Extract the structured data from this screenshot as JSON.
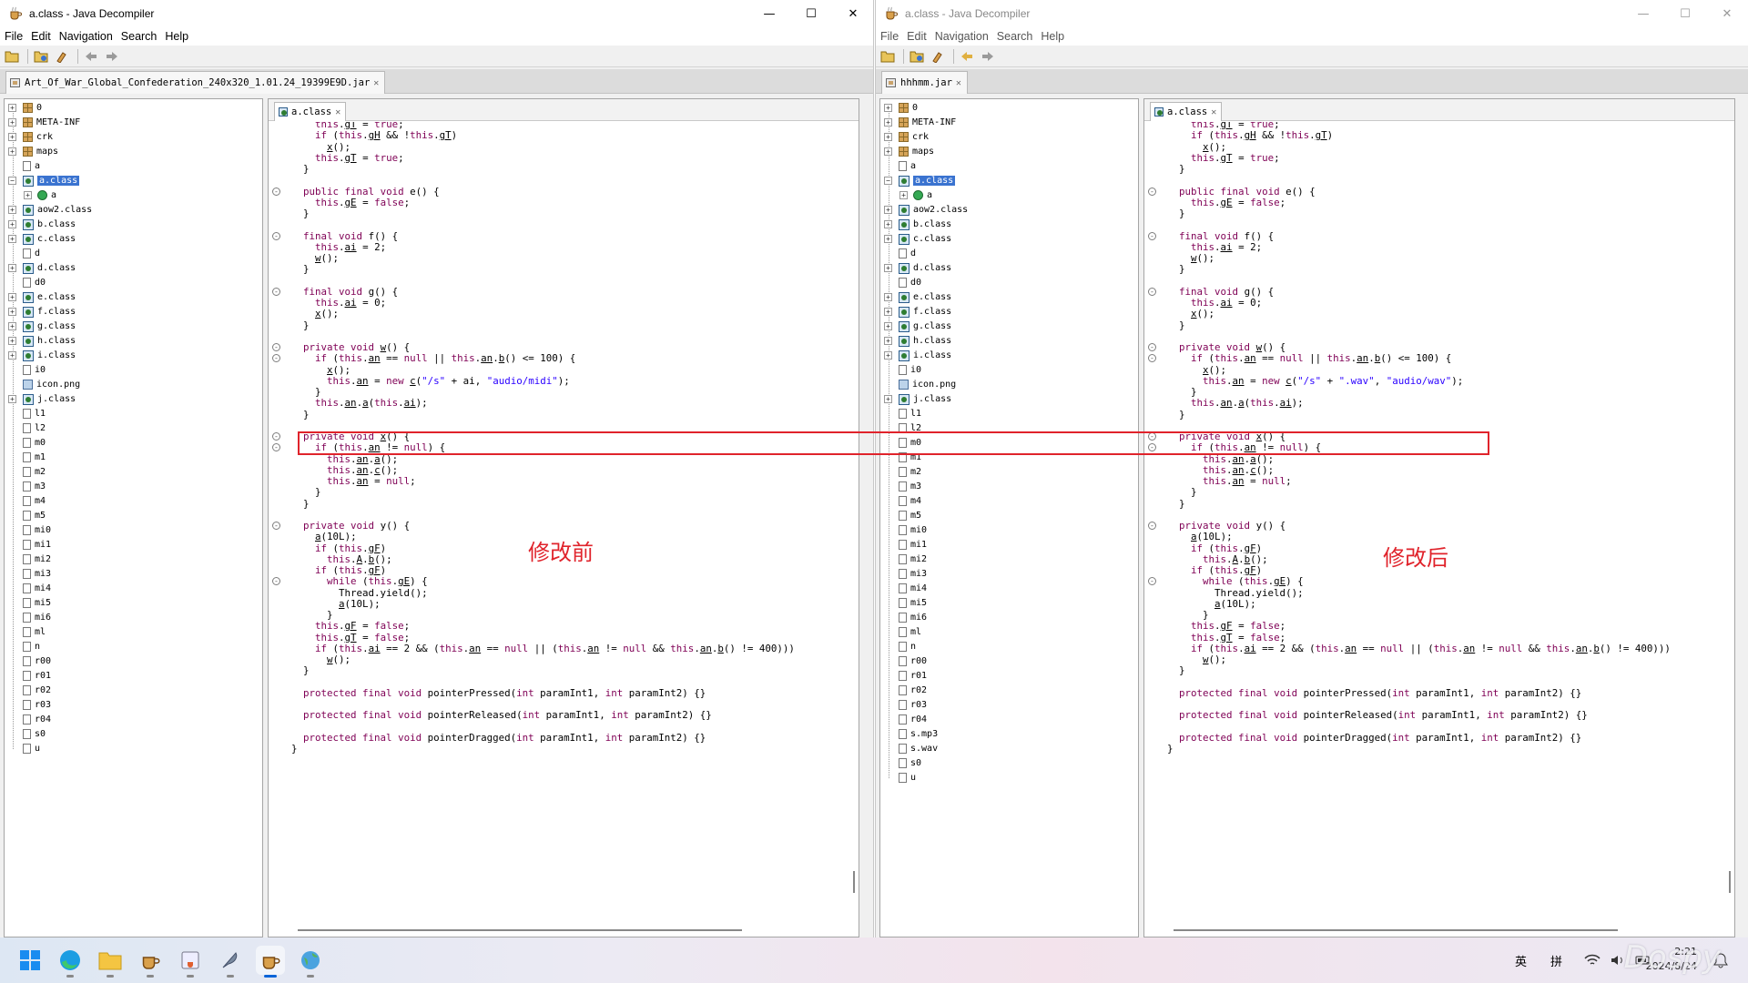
{
  "windows": [
    {
      "title": "a.class - Java Decompiler",
      "menu": [
        "File",
        "Edit",
        "Navigation",
        "Search",
        "Help"
      ],
      "file_tab": "Art_Of_War_Global_Confederation_240x320_1.01.24_19399E9D.jar",
      "editor_tab": "a.class",
      "tree": [
        "0",
        "META-INF",
        "crk",
        "maps",
        "a",
        "a.class",
        "a",
        "aow2.class",
        "b.class",
        "c.class",
        "d",
        "d.class",
        "d0",
        "e.class",
        "f.class",
        "g.class",
        "h.class",
        "i.class",
        "i0",
        "icon.png",
        "j.class",
        "l1",
        "l2",
        "m0",
        "m1",
        "m2",
        "m3",
        "m4",
        "m5",
        "mi0",
        "mi1",
        "mi2",
        "mi3",
        "mi4",
        "mi5",
        "mi6",
        "ml",
        "n",
        "r00",
        "r01",
        "r02",
        "r03",
        "r04",
        "s0",
        "u"
      ],
      "annotation": "修改前",
      "highlight_line": "this.an = new c(\"/s\" + ai, \"audio/midi\");"
    },
    {
      "title": "a.class - Java Decompiler",
      "menu": [
        "File",
        "Edit",
        "Navigation",
        "Search",
        "Help"
      ],
      "file_tab": "hhhmm.jar",
      "editor_tab": "a.class",
      "tree": [
        "0",
        "META-INF",
        "crk",
        "maps",
        "a",
        "a.class",
        "a",
        "aow2.class",
        "b.class",
        "c.class",
        "d",
        "d.class",
        "d0",
        "e.class",
        "f.class",
        "g.class",
        "h.class",
        "i.class",
        "i0",
        "icon.png",
        "j.class",
        "l1",
        "l2",
        "m0",
        "m1",
        "m2",
        "m3",
        "m4",
        "m5",
        "mi0",
        "mi1",
        "mi2",
        "mi3",
        "mi4",
        "mi5",
        "mi6",
        "ml",
        "n",
        "r00",
        "r01",
        "r02",
        "r03",
        "r04",
        "s.mp3",
        "s.wav",
        "s0",
        "u"
      ],
      "annotation": "修改后",
      "highlight_line": "this.an = new c(\"/s\" + \".wav\", \"audio/wav\");"
    }
  ],
  "code_lines": [
    "    this.gT = true;",
    "    if (this.gH && !this.gT)",
    "      x();",
    "    this.gT = true;",
    "  }",
    "",
    "  public final void e() {",
    "    this.gE = false;",
    "  }",
    "",
    "  final void f() {",
    "    this.ai = 2;",
    "    w();",
    "  }",
    "",
    "  final void g() {",
    "    this.ai = 0;",
    "    x();",
    "  }",
    "",
    "  private void w() {",
    "    if (this.an == null || this.an.b() <= 100) {",
    "      x();",
    "      __HL__",
    "    }",
    "    this.an.a(this.ai);",
    "  }",
    "",
    "  private void x() {",
    "    if (this.an != null) {",
    "      this.an.a();",
    "      this.an.c();",
    "      this.an = null;",
    "    }",
    "  }",
    "",
    "  private void y() {",
    "    a(10L);",
    "    if (this.gF)",
    "      this.A.b();",
    "    if (this.gF)",
    "      while (this.gE) {",
    "        Thread.yield();",
    "        a(10L);",
    "      }",
    "    this.gF = false;",
    "    this.gT = false;",
    "    if (this.ai == 2 && (this.an == null || (this.an != null && this.an.b() != 400)))",
    "      w();",
    "  }",
    "",
    "  protected final void pointerPressed(int paramInt1, int paramInt2) {}",
    "",
    "  protected final void pointerReleased(int paramInt1, int paramInt2) {}",
    "",
    "  protected final void pointerDragged(int paramInt1, int paramInt2) {}",
    "}"
  ],
  "fold_markers": [
    "-",
    "-",
    "-",
    "-",
    "-",
    "-",
    "-",
    "-",
    "-",
    "-"
  ],
  "taskbar": {
    "apps": [
      "windows-start",
      "edge-browser",
      "file-explorer",
      "java-decompiler",
      "java-app",
      "feather-app",
      "java-decompiler-active",
      "globe-app"
    ],
    "ime1": "英",
    "ime2": "拼",
    "time": "2:21",
    "date": "2024/8/24",
    "watermark": "Dospy"
  },
  "colors": {
    "highlight": "#e0232b",
    "selection": "#3a73d0",
    "keyword": "#7f0055",
    "string": "#2a00ff"
  }
}
